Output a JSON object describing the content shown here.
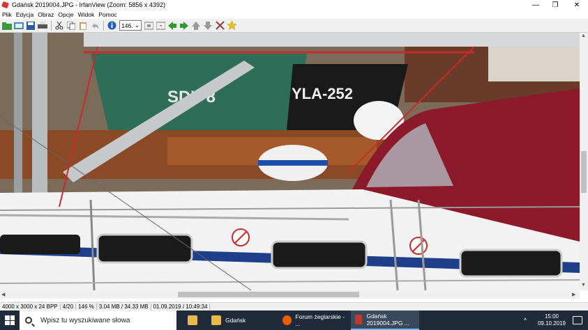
{
  "window": {
    "title": "Gdańsk 2019004.JPG - IrfanView (Zoom: 5856 x 4392)",
    "minimize": "—",
    "maximize": "❐",
    "close": "✕"
  },
  "menu": [
    "Plik",
    "Edycja",
    "Obraz",
    "Opcje",
    "Widok",
    "Pomoc"
  ],
  "toolbar": {
    "zoom_value": "146.",
    "icons": [
      "open-folder-icon",
      "slideshow-icon",
      "save-icon",
      "print-icon",
      "cut-icon",
      "copy-icon",
      "paste-icon",
      "undo-icon",
      "info-icon",
      "zoom-in-icon",
      "zoom-out-icon",
      "prev-icon",
      "next-icon",
      "up-icon",
      "down-icon",
      "tools-icon",
      "star-icon"
    ]
  },
  "image": {
    "description_text_on_hull": "YLA-252",
    "hull_text_left": "SDY 8"
  },
  "status": {
    "dimensions": "4000 x 3000 x 24 BPP",
    "index": "4/20",
    "zoom": "146 %",
    "size": "3.04 MB / 34.33 MB",
    "datetime": "01.09.2019 / 10:49:34"
  },
  "taskbar": {
    "search_placeholder": "Wpisz tu wyszukiwane słowa",
    "apps": [
      {
        "label": "Gdańsk",
        "color": "#e8b84a",
        "active": false
      },
      {
        "label": "Forum żeglarskie - ...",
        "color": "#e66000",
        "active": false
      },
      {
        "label": "Gdańsk 2019004.JPG ...",
        "color": "#c0392b",
        "active": true
      }
    ],
    "time": "15:00",
    "date": "09.10.2019"
  },
  "colors": {
    "canopy": "#8c1a2a",
    "hull_white": "#f2f2f2",
    "green_boat": "#2e6e58",
    "black_boat": "#1a1a1a"
  }
}
